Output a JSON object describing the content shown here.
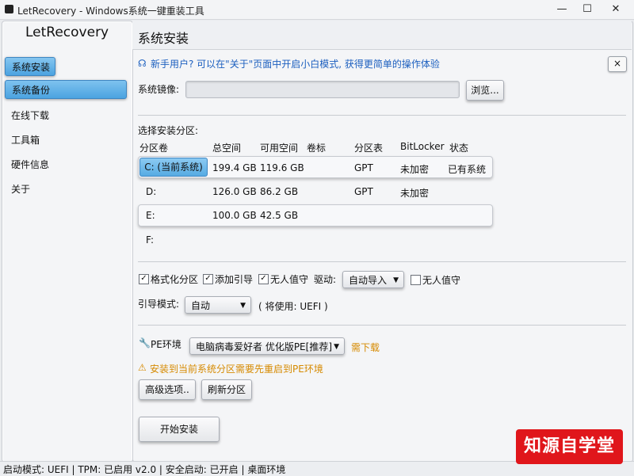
{
  "window": {
    "title": "LetRecovery - Windows系统一键重装工具",
    "minimize": "—",
    "maximize": "☐",
    "close": "✕"
  },
  "sidebar": {
    "app_name": "LetRecovery",
    "items": [
      {
        "label": "系统安装"
      },
      {
        "label": "系统备份"
      },
      {
        "label": "在线下载"
      },
      {
        "label": "工具箱"
      },
      {
        "label": "硬件信息"
      },
      {
        "label": "关于"
      }
    ]
  },
  "main": {
    "title": "系统安装",
    "tip": "新手用户? 可以在\"关于\"页面中开启小白模式, 获得更简单的操作体验",
    "tip_close": "×",
    "image_label": "系统镜像:",
    "image_value": "",
    "browse_label": "浏览...",
    "partition_section_label": "选择安装分区:",
    "table_headers": [
      "分区卷",
      "总空间",
      "可用空间",
      "卷标",
      "分区表",
      "BitLocker",
      "状态"
    ],
    "partitions": [
      {
        "volume": "C: (当前系统)",
        "total": "199.4 GB",
        "free": "119.6 GB",
        "label": "",
        "table": "GPT",
        "bitlocker": "未加密",
        "status": "已有系统"
      },
      {
        "volume": "D:",
        "total": "126.0 GB",
        "free": "86.2 GB",
        "label": "",
        "table": "GPT",
        "bitlocker": "未加密",
        "status": ""
      },
      {
        "volume": "E:",
        "total": "100.0 GB",
        "free": "42.5 GB",
        "label": "",
        "table": "",
        "bitlocker": "",
        "status": ""
      },
      {
        "volume": "F:",
        "total": "",
        "free": "",
        "label": "",
        "table": "",
        "bitlocker": "",
        "status": ""
      }
    ],
    "options": {
      "format_label": "格式化分区",
      "format_checked": true,
      "add_boot_label": "添加引导",
      "add_boot_checked": true,
      "unattended_label": "无人值守",
      "unattended_checked": true,
      "driver_label": "驱动:",
      "driver_value": "自动导入",
      "driver_unattended_label": "无人值守",
      "driver_unattended_checked": false
    },
    "boot_mode_label": "引导模式:",
    "boot_mode_value": "自动",
    "boot_mode_note": "( 将使用: UEFI )",
    "pe_label": "PE环境",
    "pe_value": "电脑病毒爱好者 优化版PE[推荐]",
    "pe_need_download": "需下载",
    "pe_warning": "安装到当前系统分区需要先重启到PE环境",
    "advanced_button": "高级选项..",
    "refresh_button": "刷新分区",
    "start_button": "开始安装"
  },
  "statusbar": {
    "text": "启动模式: UEFI | TPM: 已启用 v2.0 | 安全启动: 已开启 | 桌面环境"
  },
  "watermark": {
    "text": "知源自学堂"
  },
  "colors": {
    "accent": "#4ba3e0",
    "tip_blue": "#1c5fbf",
    "warning": "#d68a00",
    "watermark_red": "#e0161b"
  }
}
